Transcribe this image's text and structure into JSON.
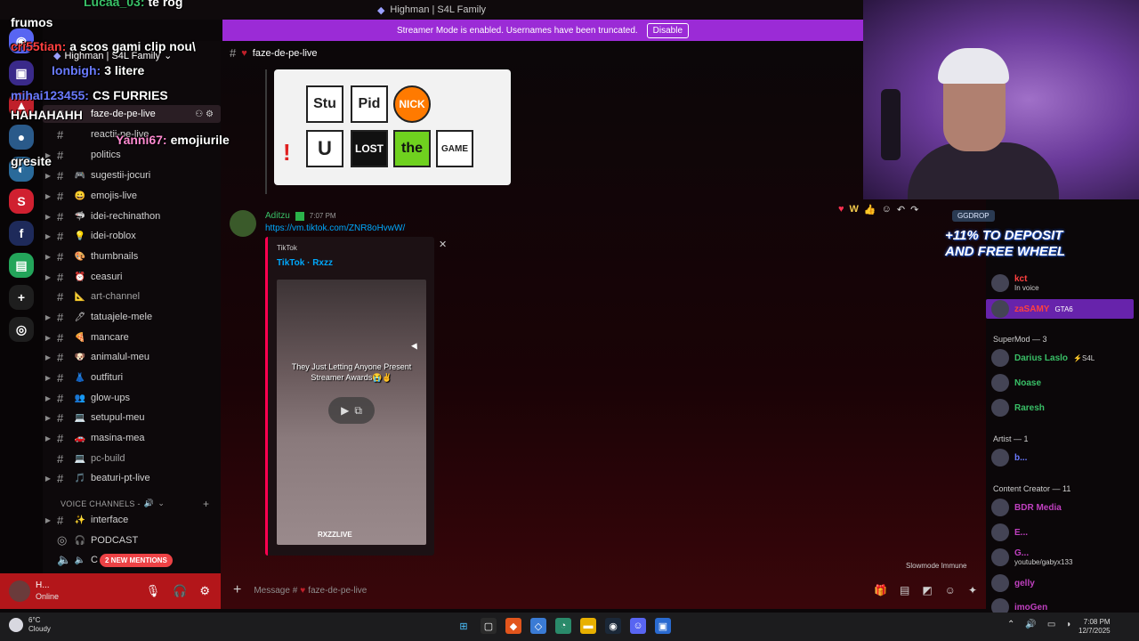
{
  "window": {
    "title": "Highman | S4L Family"
  },
  "banner": {
    "text": "Streamer Mode is enabled. Usernames have been truncated.",
    "button": "Disable"
  },
  "guild": {
    "name": "Highman | S4L Family"
  },
  "channel_header": {
    "name": "faze-de-pe-live"
  },
  "sidebar": {
    "channels": [
      {
        "name": "faze-de-pe-live",
        "emoji": "",
        "active": true
      },
      {
        "name": "reactii-pe-live",
        "emoji": ""
      },
      {
        "name": "politics",
        "emoji": ""
      },
      {
        "name": "sugestii-jocuri",
        "emoji": "🎮"
      },
      {
        "name": "emojis-live",
        "emoji": "😀"
      },
      {
        "name": "idei-rechinathon",
        "emoji": "🦈"
      },
      {
        "name": "idei-roblox",
        "emoji": "💡"
      },
      {
        "name": "thumbnails",
        "emoji": "🎨"
      },
      {
        "name": "ceasuri",
        "emoji": "⏰"
      },
      {
        "name": "art-channel",
        "emoji": "📐"
      },
      {
        "name": "tatuajele-mele",
        "emoji": "🖊"
      },
      {
        "name": "mancare",
        "emoji": "🍕"
      },
      {
        "name": "animalul-meu",
        "emoji": "🐶"
      },
      {
        "name": "outfituri",
        "emoji": "👗"
      },
      {
        "name": "glow-ups",
        "emoji": "👥"
      },
      {
        "name": "setupul-meu",
        "emoji": "💻"
      },
      {
        "name": "masina-mea",
        "emoji": "🚗"
      },
      {
        "name": "pc-build",
        "emoji": "💻"
      },
      {
        "name": "beaturi-pt-live",
        "emoji": "🎵"
      }
    ],
    "voice_category": "VOICE CHANNELS -",
    "voice_channels": [
      {
        "name": "interface",
        "emoji": "✨"
      },
      {
        "name": "PODCAST",
        "emoji": ""
      },
      {
        "name": "C",
        "emoji": ""
      }
    ]
  },
  "mentions_badge": "2 NEW MENTIONS",
  "user_panel": {
    "name": "H...",
    "status": "Online"
  },
  "overlay_chat": [
    {
      "user": "",
      "text": "frumos",
      "color": "#ffffff"
    },
    {
      "user": "cri55tian:",
      "text": "a scos gami clip nou\\",
      "color": "#ff4040"
    },
    {
      "user": "Ionbigh:",
      "text": "3 litere",
      "color": "#6a7aff"
    },
    {
      "user": "mihai123455:",
      "text": "CS FURRIES",
      "color": "#6a7aff"
    },
    {
      "user": "",
      "text": "HAHAHAHH",
      "color": "#ffffff"
    },
    {
      "user": "Yanni67:",
      "text": "emojiurile",
      "color": "#ff8ad0"
    },
    {
      "user": "",
      "text": "gresite",
      "color": "#ffffff"
    },
    {
      "user": "Lucaa_03:",
      "text": "te rog",
      "color": "#39c067"
    }
  ],
  "meme_tiles": [
    "Stu",
    "Pid",
    "NICK",
    "U",
    "LOST",
    "the",
    "GAME"
  ],
  "message": {
    "author": "Aditzu",
    "time": "7:07 PM",
    "link": "https://vm.tiktok.com/ZNR8oHvwW/",
    "embed": {
      "provider": "TikTok",
      "title": "TikTok · Rxzz",
      "caption": "They Just Letting Anyone Present Streamer Awards😭✌",
      "watermark": "RXZZLIVE"
    }
  },
  "composer": {
    "placeholder": "Message #",
    "channel": "faze-de-pe-live"
  },
  "slowmode": "Slowmode Immune",
  "ad": {
    "tag": "GGDROP",
    "line1": "+11% TO DEPOSIT",
    "line2": "AND FREE WHEEL"
  },
  "members": {
    "top_users": [
      {
        "name": "kct",
        "sub": "In voice",
        "color": "#ff4040"
      },
      {
        "name": "zaSAMY",
        "sub": "GTA6",
        "color": "#ff4040"
      }
    ],
    "supermod_header": "SuperMod — 3",
    "supermods": [
      {
        "name": "Darius Laslo",
        "tag": "⚡S4L",
        "color": "#39c067"
      },
      {
        "name": "Noase",
        "color": "#39c067"
      },
      {
        "name": "Raresh",
        "color": "#39c067"
      }
    ],
    "artist_header": "Artist — 1",
    "artists": [
      {
        "name": "b...",
        "color": "#6a7aff"
      }
    ],
    "creator_header": "Content Creator — 11",
    "creators": [
      {
        "name": "BDR Media",
        "color": "#c040c0"
      },
      {
        "name": "E...",
        "color": "#c040c0"
      },
      {
        "name": "G...",
        "sub": "youtube/gabyx133",
        "color": "#c040c0"
      },
      {
        "name": "gelly",
        "color": "#c040c0"
      },
      {
        "name": "imoGen",
        "color": "#c040c0"
      }
    ]
  },
  "taskbar": {
    "temp": "6°C",
    "weather": "Cloudy",
    "time": "7:08 PM",
    "date": "12/7/2025"
  },
  "icons": [
    "discord-icon",
    "search-icon",
    "gear-icon",
    "mic-icon",
    "headphones-icon",
    "play-icon",
    "plus-icon",
    "close-icon"
  ]
}
